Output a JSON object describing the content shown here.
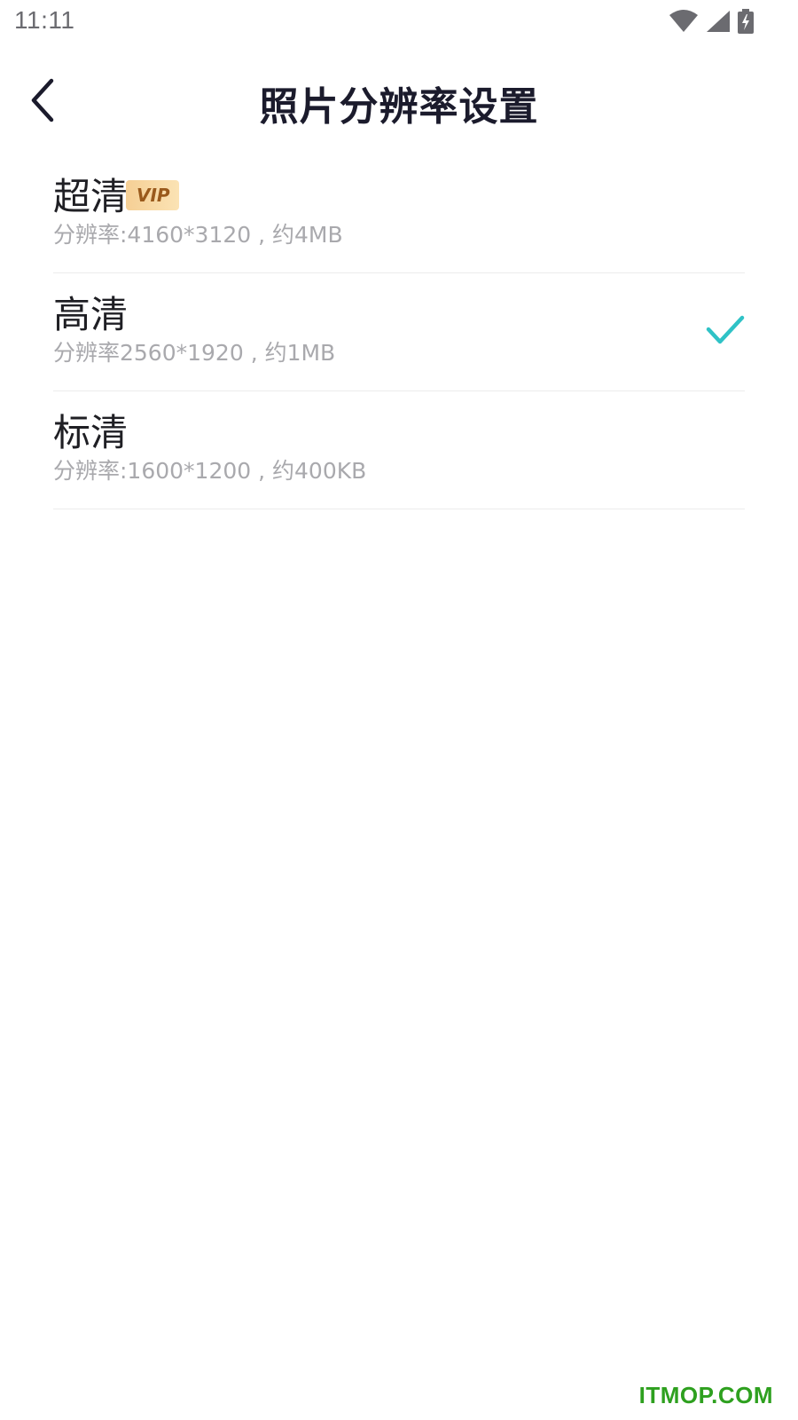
{
  "status_bar": {
    "time": "11:11",
    "icons": [
      "wifi-icon",
      "signal-icon",
      "battery-charging-icon"
    ],
    "icon_color": "#6b6b70"
  },
  "header": {
    "title": "照片分辨率设置",
    "back_icon": "chevron-left-icon"
  },
  "options": [
    {
      "title": "超清",
      "badge": "VIP",
      "description": "分辨率:4160*3120 , 约4MB",
      "selected": false
    },
    {
      "title": "高清",
      "badge": "",
      "description": "分辨率2560*1920 , 约1MB",
      "selected": true
    },
    {
      "title": "标清",
      "badge": "",
      "description": "分辨率:1600*1200 , 约400KB",
      "selected": false
    }
  ],
  "colors": {
    "accent_check": "#2fc2c6",
    "vip_badge_bg": "#f7d7a0",
    "vip_badge_text": "#9a5a1c",
    "watermark": "#2ea01f"
  },
  "watermark": "ITMOP.COM"
}
